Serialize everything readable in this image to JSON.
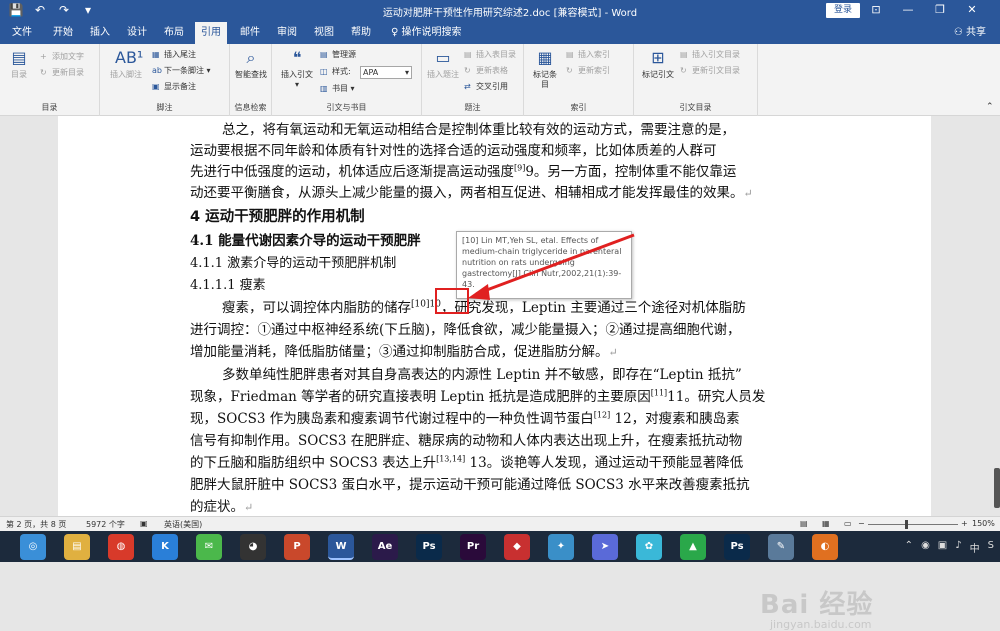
{
  "titlebar": {
    "quick_access": [
      "💾",
      "↶",
      "↷",
      "▾"
    ],
    "doc_title": "运动对肥胖干预性作用研究综述2.doc [兼容模式] - Word",
    "login_label": "登录",
    "controls": [
      "⊡",
      "—",
      "❐",
      "✕"
    ]
  },
  "tabs": [
    {
      "label": "文件"
    },
    {
      "label": "开始"
    },
    {
      "label": "插入"
    },
    {
      "label": "设计"
    },
    {
      "label": "布局"
    },
    {
      "label": "引用"
    },
    {
      "label": "邮件"
    },
    {
      "label": "审阅"
    },
    {
      "label": "视图"
    },
    {
      "label": "帮助"
    },
    {
      "label": "操作说明搜索"
    }
  ],
  "share_label": "共享",
  "ribbon": {
    "toc": {
      "big": "目录",
      "add_text": "添加文字",
      "update": "更新目录",
      "group": "目录"
    },
    "footnote": {
      "big": "插入脚注",
      "insert_endnote": "插入尾注",
      "next_footnote": "下一条脚注",
      "show_notes": "显示备注",
      "group": "脚注"
    },
    "search": {
      "big": "智能查找",
      "group": "信息检索"
    },
    "citation": {
      "big": "插入引文",
      "manage": "管理源",
      "style_label": "样式:",
      "style_value": "APA",
      "bibliography": "书目",
      "group": "引文与书目"
    },
    "captions": {
      "big": "插入题注",
      "insert_table": "插入表目录",
      "update_table": "更新表格",
      "cross_ref": "交叉引用",
      "group": "题注"
    },
    "index": {
      "big": "标记条目",
      "insert_index": "插入索引",
      "update_index": "更新索引",
      "group": "索引"
    },
    "toa": {
      "big": "标记引文",
      "insert_toa": "插入引文目录",
      "update_toa": "更新引文目录",
      "group": "引文目录"
    }
  },
  "document": {
    "p1_l1": "总之，将有氧运动和无氧运动相结合是控制体重比较有效的运动方式，需要注意的是，",
    "p1_l2": "运动要根据不同年龄和体质有针对性的选择合适的运动强度和频率，比如体质差的人群可",
    "p1_l3": "先进行中低强度的运动，机体适应后逐渐提高运动强度",
    "p1_l3_cite": "[9]",
    "p1_l3_b": "9。另一方面，控制体重不能仅靠运",
    "p1_l4": "动还要平衡膳食，从源头上减少能量的摄入，两者相互促进、相辅相成才能发挥最佳的效果。",
    "h1": "4  运动干预肥胖的作用机制",
    "h2": "4.1  能量代谢因素介导的运动干预肥胖",
    "h3a": "4.1.1  激素介导的运动干预肥胖机制",
    "h3b": "4.1.1.1  瘦素",
    "p2_l1a": "瘦素，可以调控体内脂肪的储存",
    "p2_l1_cite": "[10]10",
    "p2_l1b": "，研究发现，Leptin 主要通过三个途径对机体脂肪",
    "p2_l2": "进行调控：①通过中枢神经系统(下丘脑)，降低食欲，减少能量摄入；②通过提高细胞代谢，",
    "p2_l3": "增加能量消耗，降低脂肪储量；③通过抑制脂肪合成，促进脂肪分解。",
    "p3_l1": "多数单纯性肥胖患者对其自身高表达的内源性 Leptin 并不敏感，即存在“Leptin 抵抗”",
    "p3_l2a": "现象，Friedman 等学者的研究直接表明 Leptin 抵抗是造成肥胖的主要原因",
    "p3_l2_cite": "[11]",
    "p3_l2b": "11。研究人员发",
    "p3_l3a": "现，SOCS3 作为胰岛素和瘦素调节代谢过程中的一种负性调节蛋白",
    "p3_l3_cite": "[12]",
    "p3_l3b": " 12，对瘦素和胰岛素",
    "p3_l4": "信号有抑制作用。SOCS3 在肥胖症、糖尿病的动物和人体内表达出现上升，在瘦素抵抗动物",
    "p3_l5a": "的下丘脑和脂肪组织中 SOCS3 表达上升",
    "p3_l5_cite": "[13,14]",
    "p3_l5b": " 13。谈艳等人发现，通过运动干预能显著降低",
    "p3_l6": "肥胖大鼠肝脏中 SOCS3 蛋白水平，提示运动干预可能通过降低 SOCS3 水平来改善瘦素抵抗",
    "p3_l7": "的症状。",
    "tooltip": "[10] Lin MT,Yeh SL, etal. Effects of medium-chain triglyceride in parenteral nutrition on rats undergoing gastrectomy[J].Clin Nutr,2002,21(1):39-43."
  },
  "status": {
    "page": "第 2 页，共 8 页",
    "words": "5972 个字",
    "lang": "英语(美国)",
    "zoom": "150%"
  },
  "watermark": {
    "main": "Bai 经验",
    "sub": "jingyan.baidu.com"
  },
  "taskbar_apps": [
    {
      "name": "browser",
      "glyph": "◎",
      "color": "#3a8fd8"
    },
    {
      "name": "explorer",
      "glyph": "▤",
      "color": "#e0b040"
    },
    {
      "name": "netease",
      "glyph": "◍",
      "color": "#d83a2a"
    },
    {
      "name": "kugou",
      "glyph": "K",
      "color": "#2a7fd8"
    },
    {
      "name": "wechat",
      "glyph": "✉",
      "color": "#4bb84b"
    },
    {
      "name": "qq",
      "glyph": "◕",
      "color": "#333"
    },
    {
      "name": "powerpoint",
      "glyph": "P",
      "color": "#c9482b"
    },
    {
      "name": "word",
      "glyph": "W",
      "color": "#2b579a"
    },
    {
      "name": "after-effects",
      "glyph": "Ae",
      "color": "#2b1a4a"
    },
    {
      "name": "photoshop",
      "glyph": "Ps",
      "color": "#0a2a4a"
    },
    {
      "name": "premiere",
      "glyph": "Pr",
      "color": "#2a0a3a"
    },
    {
      "name": "app-red",
      "glyph": "◆",
      "color": "#c83030"
    },
    {
      "name": "app-bird",
      "glyph": "✦",
      "color": "#3a8fc8"
    },
    {
      "name": "app-plane",
      "glyph": "➤",
      "color": "#5a6ad8"
    },
    {
      "name": "app-cloud",
      "glyph": "✿",
      "color": "#3ab8d8"
    },
    {
      "name": "app-green",
      "glyph": "▲",
      "color": "#2aa84a"
    },
    {
      "name": "photoshop2",
      "glyph": "Ps",
      "color": "#0a2a4a"
    },
    {
      "name": "app-pen",
      "glyph": "✎",
      "color": "#5a7a9a"
    },
    {
      "name": "app-orange",
      "glyph": "◐",
      "color": "#e07020"
    }
  ],
  "tray": [
    "⌃",
    "◉",
    "▣",
    "♪",
    "中",
    "S"
  ]
}
